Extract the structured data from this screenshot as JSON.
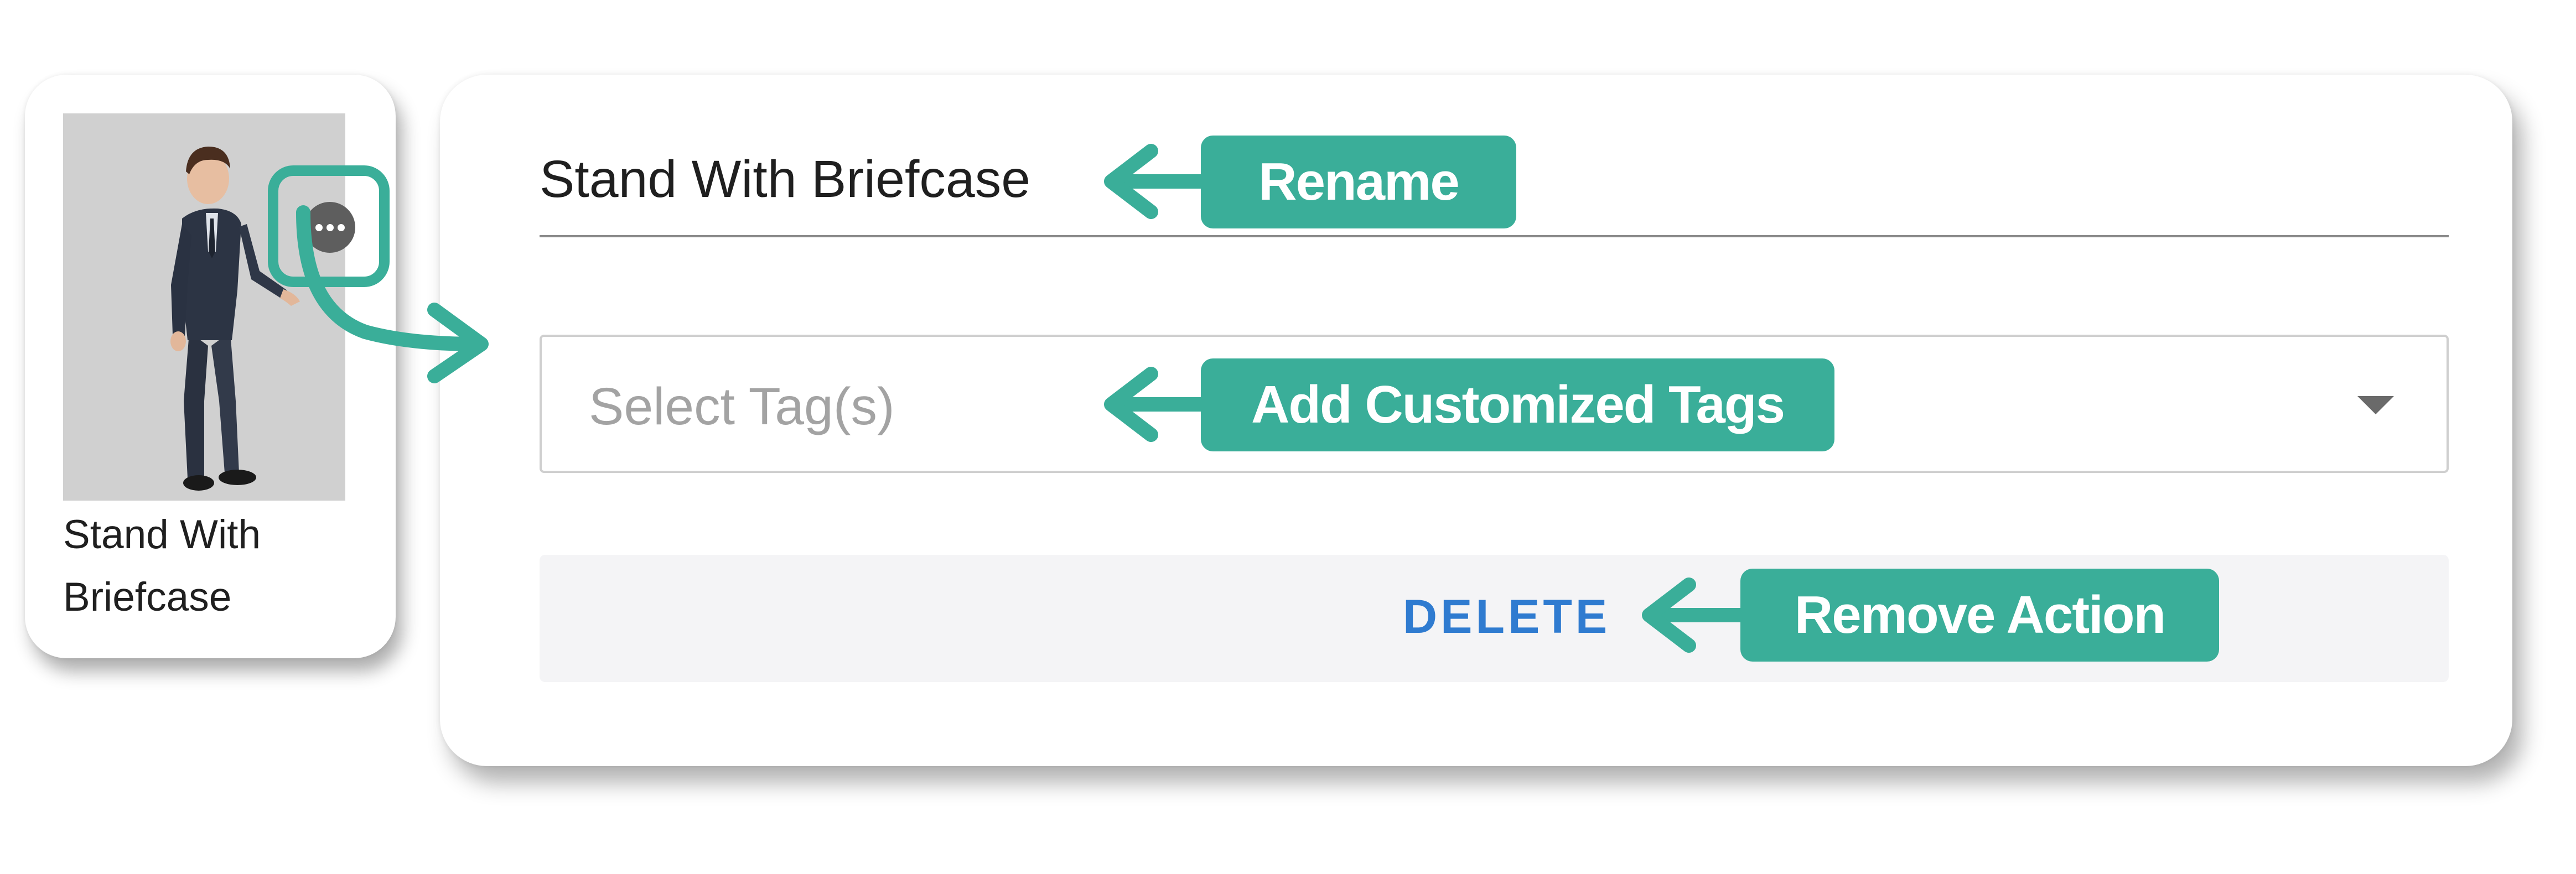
{
  "action_card": {
    "label": "Stand With Briefcase",
    "thumbnail_icon": "person-with-briefcase-figure",
    "more_icon": "ellipsis-icon"
  },
  "edit_panel": {
    "name_value": "Stand With Briefcase",
    "tags_placeholder": "Select Tag(s)",
    "tags_dropdown_icon": "caret-down-icon",
    "delete_label": "DELETE"
  },
  "callouts": {
    "rename": "Rename",
    "tags": "Add Customized Tags",
    "remove": "Remove Action"
  },
  "colors": {
    "annotation_accent": "#3aae99",
    "delete_link": "#2f7bd0",
    "thumbnail_bg": "#d0d0d0"
  }
}
